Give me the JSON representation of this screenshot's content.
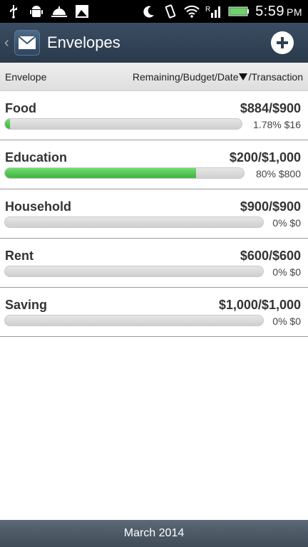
{
  "status_bar": {
    "time": "5:59",
    "ampm": "PM",
    "left_icons": [
      "usb-icon",
      "android-debug-icon",
      "bell-icon",
      "image-icon"
    ],
    "right_icons": [
      "moon-icon",
      "vibrate-icon",
      "wifi-icon",
      "signal-roaming-icon",
      "battery-icon"
    ],
    "roaming_letter": "R"
  },
  "action_bar": {
    "title": "Envelopes",
    "accent": "#2f3f52"
  },
  "column_header": {
    "left": "Envelope",
    "right_before": "Remaining/Budget/Date",
    "right_after": "/Transaction"
  },
  "envelopes": [
    {
      "name": "Food",
      "amounts": "$884/$900",
      "stats": "1.78% $16",
      "progress": 0.0178
    },
    {
      "name": "Education",
      "amounts": "$200/$1,000",
      "stats": "80% $800",
      "progress": 0.8
    },
    {
      "name": "Household",
      "amounts": "$900/$900",
      "stats": "0% $0",
      "progress": 0
    },
    {
      "name": "Rent",
      "amounts": "$600/$600",
      "stats": "0% $0",
      "progress": 0
    },
    {
      "name": "Saving",
      "amounts": "$1,000/$1,000",
      "stats": "0% $0",
      "progress": 0
    }
  ],
  "footer": {
    "label": "March 2014"
  },
  "colors": {
    "progress_fill": "#4cc24c",
    "progress_track": "#d8d8d8",
    "footer_bg": "#4a5764"
  }
}
